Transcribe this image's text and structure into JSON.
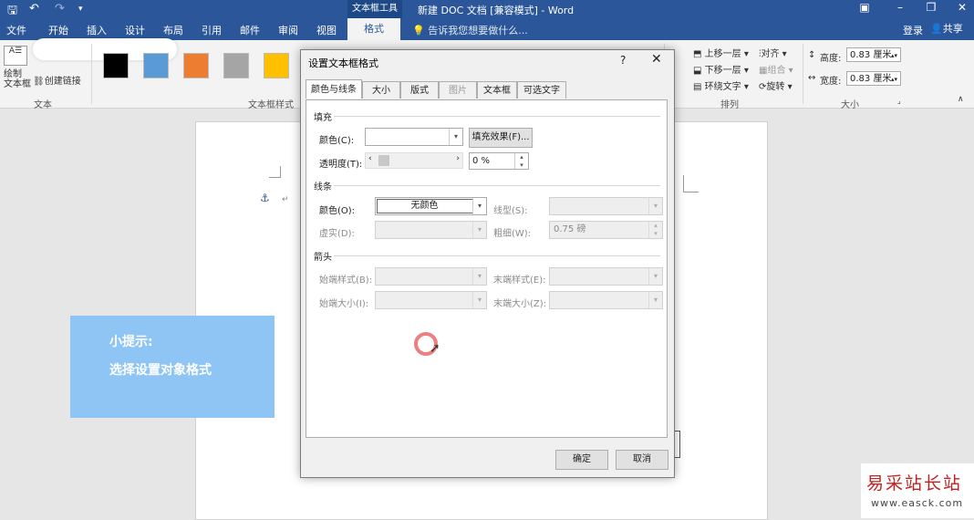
{
  "title_bar": {
    "save_icon": "save-icon",
    "undo_icon": "undo-icon",
    "redo_icon": "redo-icon",
    "contextual_tools": "文本框工具",
    "document_title": "新建 DOC 文档 [兼容模式] - Word"
  },
  "tabs": {
    "file": "文件",
    "home": "开始",
    "insert": "插入",
    "design": "设计",
    "layout": "布局",
    "references": "引用",
    "mailings": "邮件",
    "review": "审阅",
    "view": "视图",
    "format": "格式",
    "tell_me": "告诉我您想要做什么...",
    "login": "登录",
    "share": "共享"
  },
  "ribbon": {
    "draw_textbox": "绘制\n文本框",
    "create_link": "创建链接",
    "group_text": "文本",
    "group_textbox_styles": "文本框样式",
    "bring_forward": "上移一层",
    "send_backward": "下移一层",
    "wrap_text": "环绕文字",
    "align": "对齐",
    "group": "组合",
    "rotate": "旋转",
    "group_arrange": "排列",
    "height_label": "高度:",
    "height_value": "0.83 厘米",
    "width_label": "宽度:",
    "width_value": "0.83 厘米",
    "group_size": "大小",
    "swatch_colors": [
      "#000000",
      "#5b9bd5",
      "#ed7d31",
      "#a5a5a5",
      "#ffc000"
    ]
  },
  "tip": {
    "line1": "小提示:",
    "line2": "选择设置对象格式"
  },
  "dialog": {
    "title": "设置文本框格式",
    "help": "?",
    "close": "✕",
    "tabs": [
      "颜色与线条",
      "大小",
      "版式",
      "图片",
      "文本框",
      "可选文字"
    ],
    "fill_section": "填充",
    "fill_color_label": "颜色(C):",
    "fill_effects_button": "填充效果(F)...",
    "transparency_label": "透明度(T):",
    "transparency_value": "0 %",
    "line_section": "线条",
    "line_color_label": "颜色(O):",
    "line_color_value": "无颜色",
    "line_style_label": "线型(S):",
    "dash_label": "虚实(D):",
    "weight_label": "粗细(W):",
    "weight_value": "0.75 磅",
    "arrows_section": "箭头",
    "begin_style_label": "始端样式(B):",
    "end_style_label": "末端样式(E):",
    "begin_size_label": "始端大小(I):",
    "end_size_label": "末端大小(Z):",
    "ok_button": "确定",
    "cancel_button": "取消"
  },
  "watermark": {
    "line1": "易采站长站",
    "line2": "www.easck.com"
  }
}
